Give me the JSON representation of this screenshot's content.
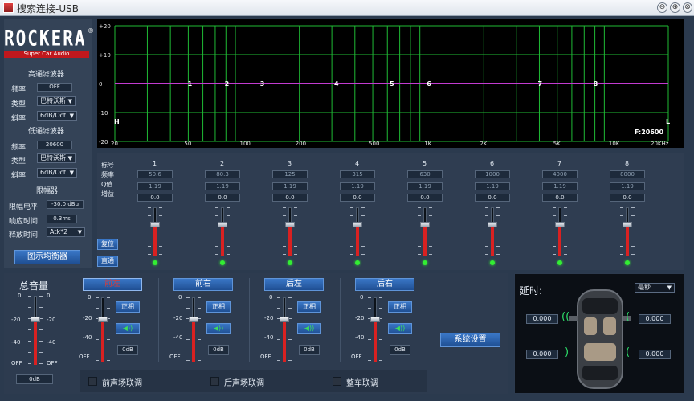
{
  "window": {
    "title": "搜索连接-USB",
    "controls": [
      "⊖",
      "⊕",
      "⊗"
    ]
  },
  "logo": {
    "brand": "ROCKERA",
    "reg": "®",
    "tagline": "Super Car Audio"
  },
  "sidebar": {
    "highpass": {
      "title": "高通滤波器",
      "freq_label": "频率:",
      "freq": "OFF",
      "type_label": "类型:",
      "type": "巴特沃斯",
      "slope_label": "斜率:",
      "slope": "6dB/Oct"
    },
    "lowpass": {
      "title": "低通滤波器",
      "freq_label": "频率:",
      "freq": "20600",
      "type_label": "类型:",
      "type": "巴特沃斯",
      "slope_label": "斜率:",
      "slope": "6dB/Oct"
    },
    "limiter": {
      "title": "限幅器",
      "level_label": "限幅电平:",
      "level": "-30.0 dBu",
      "attack_label": "响应时间:",
      "attack": "0.3ms",
      "release_label": "释放时间:",
      "release": "Atk*2"
    },
    "graphic_eq_button": "图示均衡器"
  },
  "eq": {
    "y_ticks": [
      "+20",
      "+10",
      "0",
      "-10",
      "-20"
    ],
    "x_ticks": [
      "20",
      "50",
      "100",
      "200",
      "500",
      "1K",
      "2K",
      "5K",
      "10K",
      "20KHz"
    ],
    "markers": [
      "1",
      "2",
      "3",
      "4",
      "5",
      "6",
      "7",
      "8"
    ],
    "hp_marker": "H",
    "lp_marker": "L",
    "lp_freq": "F:20600"
  },
  "chart_data": {
    "type": "line",
    "title": "",
    "xlabel": "",
    "ylabel": "",
    "xscale": "log",
    "xlim": [
      20,
      20000
    ],
    "ylim": [
      -20,
      20
    ],
    "x": [
      20,
      50,
      80.3,
      125,
      315,
      630,
      1000,
      4000,
      8000,
      20000
    ],
    "series": [
      {
        "values": [
          0,
          0,
          0,
          0,
          0,
          0,
          0,
          0,
          0,
          0
        ]
      }
    ],
    "points": [
      {
        "label": "1",
        "x": 50.6,
        "y": 0
      },
      {
        "label": "2",
        "x": 80.3,
        "y": 0
      },
      {
        "label": "3",
        "x": 125,
        "y": 0
      },
      {
        "label": "4",
        "x": 315,
        "y": 0
      },
      {
        "label": "5",
        "x": 630,
        "y": 0
      },
      {
        "label": "6",
        "x": 1000,
        "y": 0
      },
      {
        "label": "7",
        "x": 4000,
        "y": 0
      },
      {
        "label": "8",
        "x": 8000,
        "y": 0
      }
    ],
    "grid": true
  },
  "bands": {
    "row_labels": [
      "标号",
      "频率",
      "Q值",
      "增益"
    ],
    "items": [
      {
        "num": "1",
        "freq": "50.6",
        "q": "1.19",
        "gain": "0.0"
      },
      {
        "num": "2",
        "freq": "80.3",
        "q": "1.19",
        "gain": "0.0"
      },
      {
        "num": "3",
        "freq": "125",
        "q": "1.19",
        "gain": "0.0"
      },
      {
        "num": "4",
        "freq": "315",
        "q": "1.19",
        "gain": "0.0"
      },
      {
        "num": "5",
        "freq": "630",
        "q": "1.19",
        "gain": "0.0"
      },
      {
        "num": "6",
        "freq": "1000",
        "q": "1.19",
        "gain": "0.0"
      },
      {
        "num": "7",
        "freq": "4000",
        "q": "1.19",
        "gain": "0.0"
      },
      {
        "num": "8",
        "freq": "8000",
        "q": "1.19",
        "gain": "0.0"
      }
    ],
    "reset_button": "复位",
    "bypass_button": "直通"
  },
  "master": {
    "title": "总音量",
    "value": "0dB",
    "scale": [
      "0",
      "-20",
      "-40",
      "OFF"
    ]
  },
  "channels": [
    {
      "name": "前左",
      "phase": "正相",
      "mute_icon": "speaker-icon",
      "mute": "◀))",
      "level": "0dB",
      "scale": [
        "0",
        "-20",
        "-40",
        "OFF"
      ]
    },
    {
      "name": "前右",
      "phase": "正相",
      "mute_icon": "speaker-icon",
      "mute": "◀))",
      "level": "0dB",
      "scale": [
        "0",
        "-20",
        "-40",
        "OFF"
      ]
    },
    {
      "name": "后左",
      "phase": "正相",
      "mute_icon": "speaker-icon",
      "mute": "◀))",
      "level": "0dB",
      "scale": [
        "0",
        "-20",
        "-40",
        "OFF"
      ]
    },
    {
      "name": "后右",
      "phase": "正相",
      "mute_icon": "speaker-icon",
      "mute": "◀))",
      "level": "0dB",
      "scale": [
        "0",
        "-20",
        "-40",
        "OFF"
      ]
    }
  ],
  "system_settings_button": "系统设置",
  "links": [
    "前声场联调",
    "后声场联调",
    "整车联调"
  ],
  "delay": {
    "title": "延时:",
    "unit": "毫秒",
    "fl": "0.000",
    "fr": "0.000",
    "rl": "0.000",
    "rr": "0.000"
  },
  "colors": {
    "selected_channel": "#d43d3d",
    "accent": "#2f6dbf",
    "curve": "#c23bd1",
    "grid": "#1fbb35",
    "fader_fill": "#d92121",
    "led": "#33ee33"
  }
}
